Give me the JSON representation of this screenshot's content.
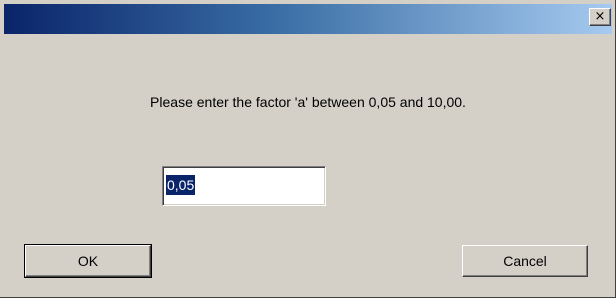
{
  "titlebar": {
    "close_glyph": "×",
    "close_icon": "close-icon"
  },
  "dialog": {
    "message": "Please enter the factor 'a' between 0,05 and 10,00.",
    "input_value": "0,05",
    "ok_label": "OK",
    "cancel_label": "Cancel"
  },
  "colors": {
    "title_gradient_start": "#0a246a",
    "title_gradient_end": "#a6caf0",
    "dialog_bg": "#d4d0c8",
    "selection_bg": "#0a246a"
  }
}
